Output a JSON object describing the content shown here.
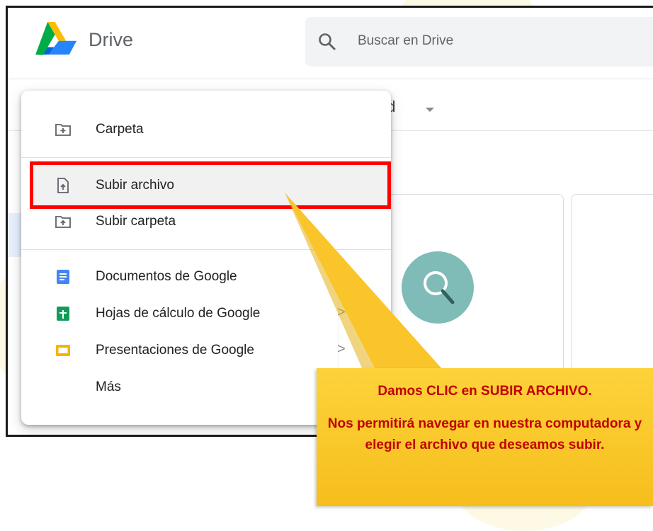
{
  "app": {
    "title": "Drive"
  },
  "search": {
    "placeholder": "Buscar en Drive"
  },
  "filter": {
    "label": "ad"
  },
  "menu": {
    "items": [
      {
        "label": "Carpeta",
        "icon": "folder-plus-icon"
      },
      {
        "label": "Subir archivo",
        "icon": "file-upload-icon"
      },
      {
        "label": "Subir carpeta",
        "icon": "folder-upload-icon"
      },
      {
        "label": "Documentos de Google",
        "icon": "google-docs-icon"
      },
      {
        "label": "Hojas de cálculo de Google",
        "icon": "google-sheets-icon",
        "submenu": ">"
      },
      {
        "label": "Presentaciones de Google",
        "icon": "google-slides-icon",
        "submenu": ">"
      },
      {
        "label": "Más"
      }
    ]
  },
  "callout": {
    "line1": "Damos CLIC en SUBIR ARCHIVO.",
    "line2": "Nos permitirá navegar en nuestra computadora y elegir el archivo que deseamos subir."
  },
  "colors": {
    "highlight": "#ff0000",
    "callout_bg": "#f6be1d",
    "callout_text": "#c00000",
    "docs_blue": "#4285f4",
    "sheets_green": "#0f9d58",
    "slides_yellow": "#f4b400"
  }
}
